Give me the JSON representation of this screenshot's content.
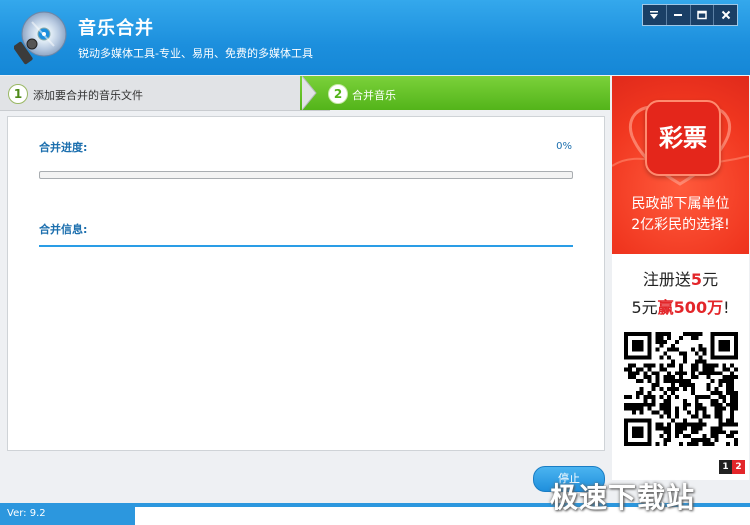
{
  "window": {
    "title": "音乐合并",
    "subtitle": "锐动多媒体工具-专业、易用、免费的多媒体工具"
  },
  "steps": [
    {
      "number": "1",
      "label": "添加要合并的音乐文件"
    },
    {
      "number": "2",
      "label": "合并音乐"
    }
  ],
  "progress": {
    "label": "合并进度:",
    "value_text": "0%",
    "fraction": 0
  },
  "info": {
    "label": "合并信息:"
  },
  "ad": {
    "badge": "彩票",
    "line1": "民政部下属单位",
    "line2": "2亿彩民的选择!",
    "line3_prefix": "注册送",
    "line3_highlight": "5",
    "line3_suffix": "元",
    "line4_prefix": "5元",
    "line4_highlight": "赢500万",
    "line4_suffix": "!",
    "pager": [
      "1",
      "2"
    ]
  },
  "buttons": {
    "stop": "停止"
  },
  "status": {
    "version": "Ver: 9.2"
  },
  "watermark": "极速下载站",
  "colors": {
    "titlebar": "#1c8fdd",
    "step_active": "#53b41a",
    "accent": "#2a9de6",
    "ad_red": "#e3262a"
  },
  "icons": [
    "music-cd-logo-icon",
    "menu-dropdown-icon",
    "minimize-icon",
    "maximize-icon",
    "close-icon"
  ]
}
